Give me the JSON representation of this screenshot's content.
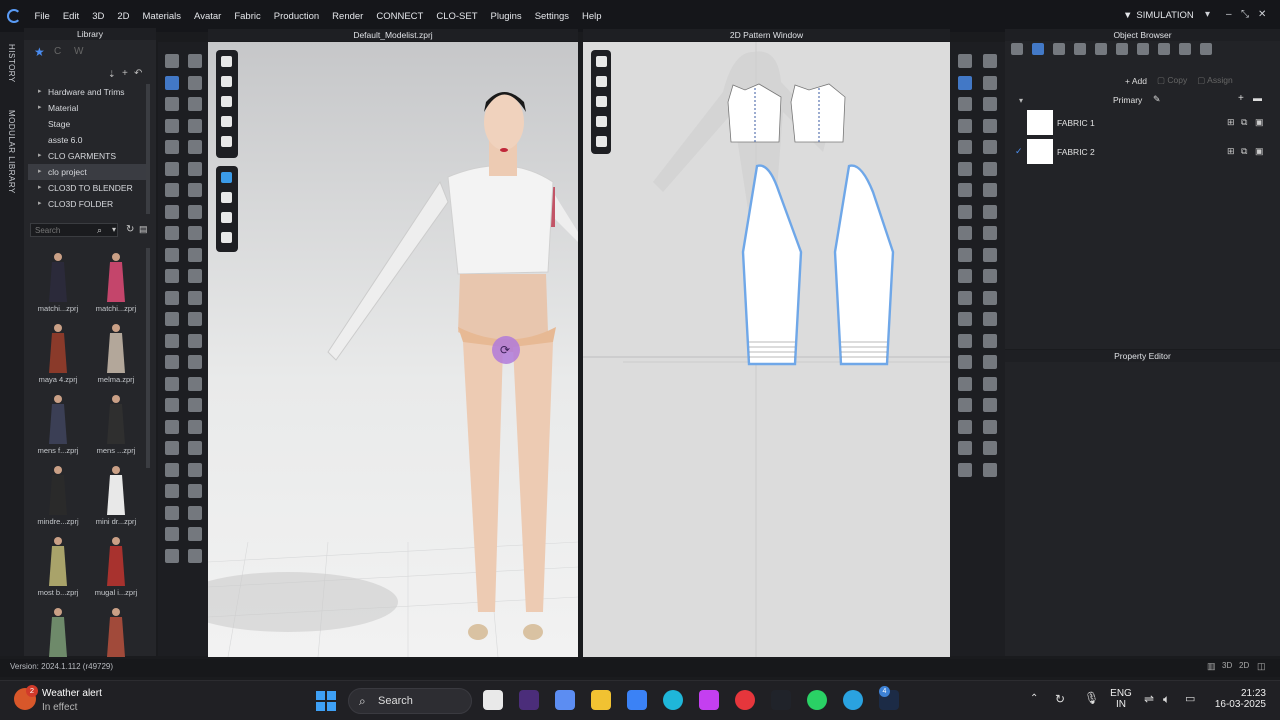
{
  "menubar": {
    "menus": [
      "File",
      "Edit",
      "3D",
      "2D",
      "Materials",
      "Avatar",
      "Fabric",
      "Production",
      "Render",
      "CONNECT",
      "CLO-SET",
      "Plugins",
      "Settings",
      "Help"
    ],
    "mode": "SIMULATION"
  },
  "sidebar": {
    "history": "HISTORY",
    "modular": "MODULAR LIBRARY"
  },
  "library": {
    "title": "Library",
    "tree": [
      "Hardware and Trims",
      "Material",
      "Stage",
      "asste 6.0",
      "CLO GARMENTS",
      "clo project",
      "CLO3D TO BLENDER",
      "CLO3D FOLDER"
    ],
    "search_placeholder": "Search",
    "thumbs": [
      {
        "label": "matchi...zprj",
        "color": "#2b2a3a"
      },
      {
        "label": "matchi...zprj",
        "color": "#c4456b"
      },
      {
        "label": "maya 4.zprj",
        "color": "#8a3a2a"
      },
      {
        "label": "melma.zprj",
        "color": "#b3a79a"
      },
      {
        "label": "mens f...zprj",
        "color": "#3b3f55"
      },
      {
        "label": "mens ...zprj",
        "color": "#2f2f2f"
      },
      {
        "label": "mindre...zprj",
        "color": "#2a2a2a"
      },
      {
        "label": "mini dr...zprj",
        "color": "#e8e8e8"
      },
      {
        "label": "most b...zprj",
        "color": "#a9a36a"
      },
      {
        "label": "mugal i...zprj",
        "color": "#a8322e"
      },
      {
        "label": "",
        "color": "#6e8a6a"
      },
      {
        "label": "",
        "color": "#a14a3a"
      }
    ]
  },
  "view3d": {
    "title": "Default_Modelist.zprj"
  },
  "view2d": {
    "title": "2D Pattern Window"
  },
  "objbrowser": {
    "title": "Object Browser",
    "add": "Add",
    "copy": "Copy",
    "assign": "Assign",
    "group": "Primary",
    "fabrics": [
      "FABRIC 1",
      "FABRIC 2"
    ]
  },
  "propeditor": {
    "title": "Property Editor"
  },
  "status": {
    "version": "Version: 2024.1.112 (r49729)"
  },
  "taskbar": {
    "weather_title": "Weather alert",
    "weather_sub": "In effect",
    "weather_badge": "2",
    "search": "Search",
    "whatsapp_badge": "4",
    "lang1": "ENG",
    "lang2": "IN",
    "time": "21:23",
    "date": "16-03-2025"
  }
}
